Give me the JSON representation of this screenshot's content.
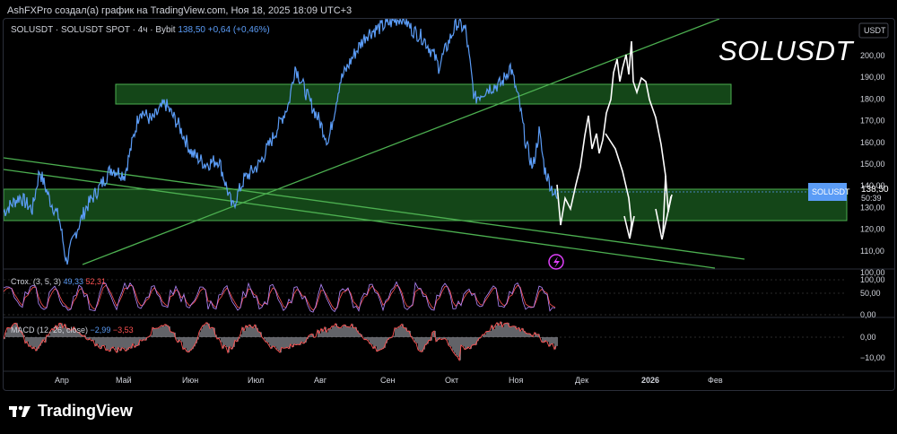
{
  "header": {
    "publish_line": "AshFXPro создал(а) график на TradingView.com, Ноя 18, 2025 18:09 UTC+3"
  },
  "legend": {
    "symbol": "SOLUSDT · SOLUSDT SPOT · 4ч · Bybit",
    "price": "138,50",
    "change": "+0,64 (+0,46%)"
  },
  "big_title": "SOLUSDT",
  "axis": {
    "currency": "USDT",
    "price_ticks": [
      "200,00",
      "190,00",
      "180,00",
      "170,00",
      "160,00",
      "150,00",
      "140,00",
      "130,00",
      "120,00",
      "110,00",
      "100,00"
    ],
    "stoch_ticks": [
      "100,00",
      "50,00",
      "0,00"
    ],
    "macd_ticks": [
      "0,00",
      "−10,00"
    ],
    "time_labels": [
      "Апр",
      "Май",
      "Июн",
      "Июл",
      "Авг",
      "Сен",
      "Окт",
      "Ноя",
      "Дек",
      "2026",
      "Фев"
    ]
  },
  "price_label": {
    "symbol": "SOLUSDT",
    "price": "138,50",
    "countdown": "50:39"
  },
  "stoch": {
    "name": "Стох. (3, 5, 3)",
    "v1": "49,33",
    "v2": "52,31"
  },
  "macd": {
    "name": "MACD (12, 26, close)",
    "v1": "−2,99",
    "v2": "−3,53"
  },
  "footer": {
    "brand": "TradingView"
  },
  "colors": {
    "price_line": "#5b9cf6",
    "zone_fill": "#1b5e20",
    "zone_border": "#4caf50",
    "trendline": "#4caf50",
    "projection": "#ffffff"
  },
  "chart_data": [
    {
      "type": "line",
      "ylim": [
        100,
        205
      ],
      "x": [
        "Апр",
        "Май",
        "Июн",
        "Июл",
        "Авг",
        "Сен",
        "Окт",
        "Ноя",
        "Дек",
        "2026",
        "Фев"
      ],
      "series": [
        {
          "values": [
            125,
            170,
            160,
            130,
            183,
            205,
            210,
            175,
            138
          ]
        }
      ],
      "zones": [
        {
          "low": 177,
          "high": 186
        },
        {
          "low": 124,
          "high": 139
        }
      ],
      "current_price": 138.5
    }
  ]
}
